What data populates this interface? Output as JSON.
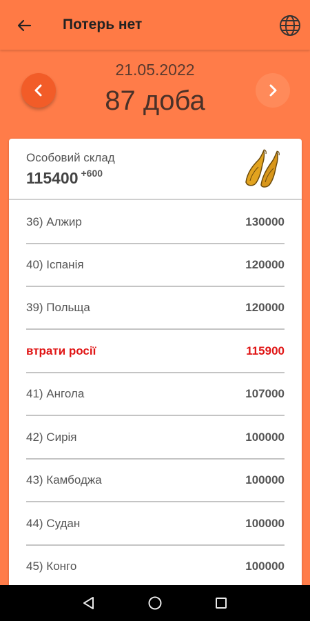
{
  "header": {
    "title": "Потерь нет"
  },
  "nav": {
    "date": "21.05.2022",
    "day": "87 доба"
  },
  "store": {
    "label": "Особовий склад",
    "value": "115400",
    "delta": "+600"
  },
  "rows": [
    {
      "name": "36) Алжир",
      "value": "130000",
      "highlight": false
    },
    {
      "name": "40) Іспанія",
      "value": "120000",
      "highlight": false
    },
    {
      "name": "39) Польща",
      "value": "120000",
      "highlight": false
    },
    {
      "name": "втрати росії",
      "value": "115900",
      "highlight": true
    },
    {
      "name": "41) Ангола",
      "value": "107000",
      "highlight": false
    },
    {
      "name": "42) Сирія",
      "value": "100000",
      "highlight": false
    },
    {
      "name": "43) Камбоджа",
      "value": "100000",
      "highlight": false
    },
    {
      "name": "44) Судан",
      "value": "100000",
      "highlight": false
    },
    {
      "name": "45) Конго",
      "value": "100000",
      "highlight": false
    }
  ],
  "colors": {
    "background": "#FF7C49",
    "accent": "#F25C28",
    "highlight": "#E01515"
  },
  "icons": {
    "back": "arrow-left-icon",
    "language": "globe-icon",
    "prev": "chevron-left-icon",
    "next": "chevron-right-icon",
    "category": "shoes-icon"
  }
}
